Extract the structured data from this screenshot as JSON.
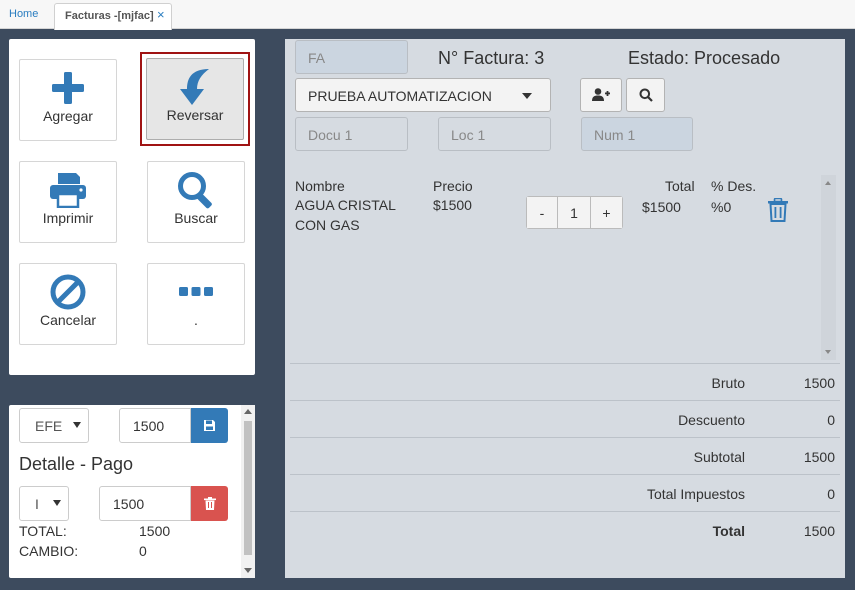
{
  "tabs": {
    "home": "Home",
    "active": "Facturas -[mjfac]",
    "close": "×"
  },
  "actions": [
    {
      "label": "Agregar",
      "icon": "plus-icon"
    },
    {
      "label": "Reversar",
      "icon": "undo-arrow-icon"
    },
    {
      "label": "Imprimir",
      "icon": "printer-icon"
    },
    {
      "label": "Buscar",
      "icon": "search-icon"
    },
    {
      "label": "Cancelar",
      "icon": "ban-icon"
    },
    {
      "label": ".",
      "icon": "ellipsis-icon"
    }
  ],
  "payment": {
    "method": "EFE",
    "amount": "1500",
    "title": "Detalle - Pago",
    "line_method": "I",
    "line_amount": "1500",
    "total_label": "TOTAL:",
    "total_value": "1500",
    "change_label": "CAMBIO:",
    "change_value": "0"
  },
  "invoice": {
    "type": "FA",
    "number_label": "N° Factura: 3",
    "status_label": "Estado: Procesado",
    "client": "PRUEBA AUTOMATIZACION",
    "docu_placeholder": "Docu 1",
    "loc_placeholder": "Loc 1",
    "num_placeholder": "Num 1"
  },
  "items": {
    "headers": {
      "name": "Nombre",
      "price": "Precio",
      "total": "Total",
      "discount": "% Des."
    },
    "rows": [
      {
        "name_line1": "AGUA CRISTAL",
        "name_line2": "CON GAS",
        "price": "$1500",
        "qty": "1",
        "minus": "-",
        "plus": "+",
        "total": "$1500",
        "discount": "%0"
      }
    ]
  },
  "summary": [
    {
      "label": "Bruto",
      "value": "1500"
    },
    {
      "label": "Descuento",
      "value": "0"
    },
    {
      "label": "Subtotal",
      "value": "1500"
    },
    {
      "label": "Total Impuestos",
      "value": "0"
    },
    {
      "label": "Total",
      "value": "1500"
    }
  ],
  "colors": {
    "primary": "#337ab7",
    "danger": "#d9534f",
    "selected_border": "#a01313",
    "background": "#3d4b5e"
  }
}
